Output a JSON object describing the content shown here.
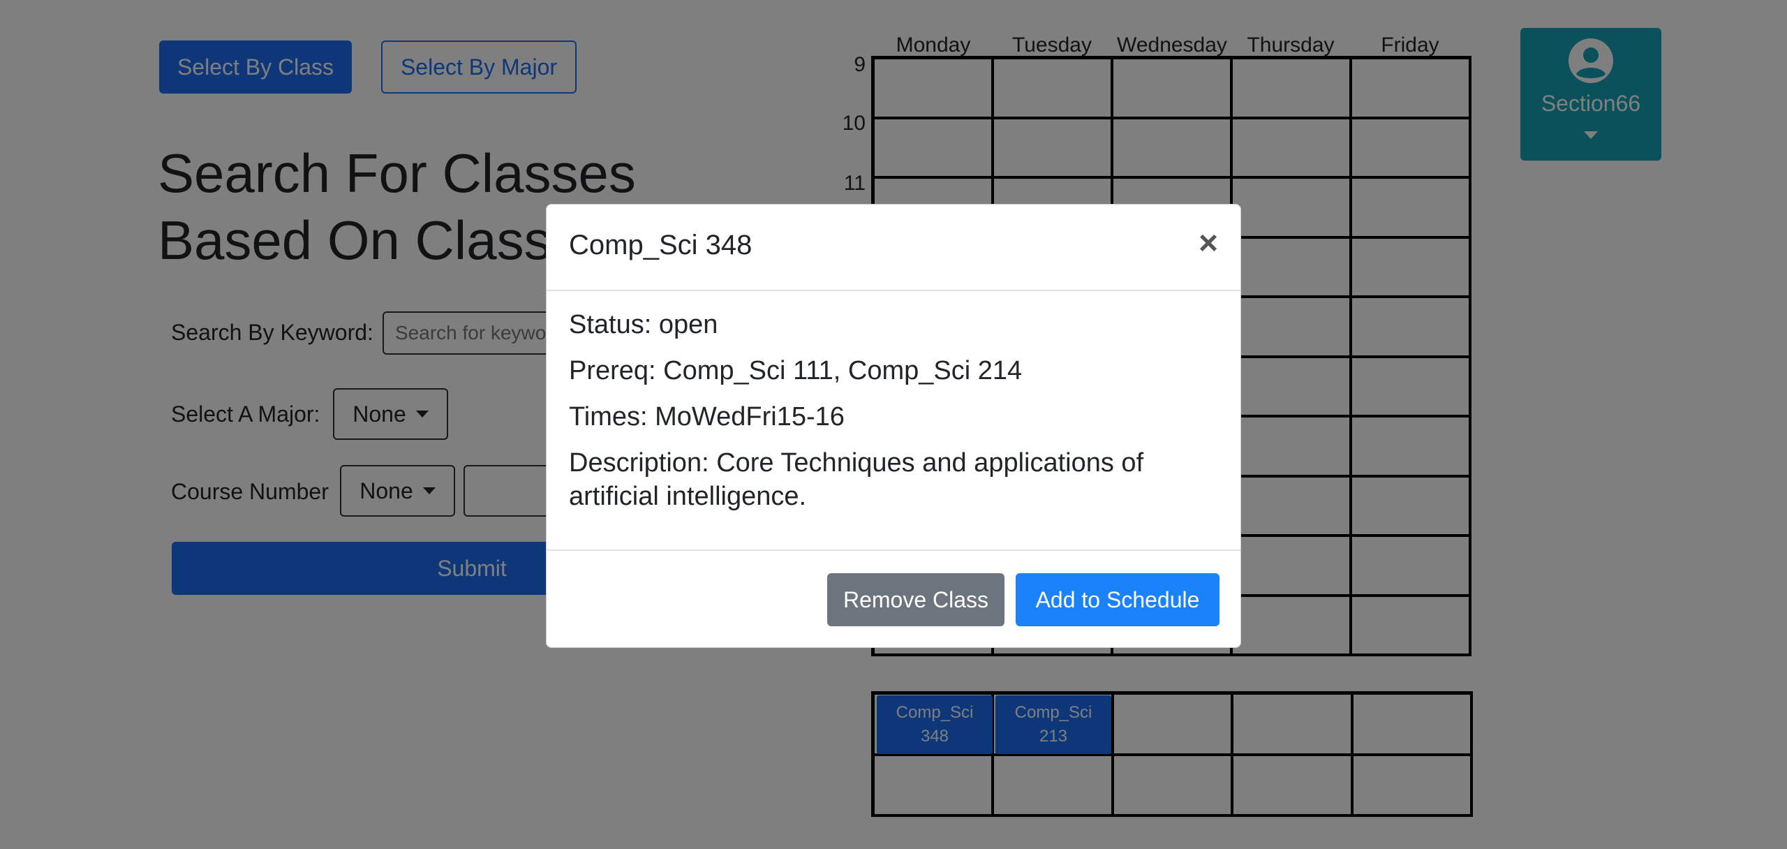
{
  "toolbar": {
    "by_class_label": "Select By Class",
    "by_major_label": "Select By Major"
  },
  "page": {
    "title_line1": "Search For Classes",
    "title_line2": "Based On Class"
  },
  "form": {
    "keyword_label": "Search By Keyword:",
    "keyword_placeholder": "Search for keywords",
    "major_label": "Select A Major:",
    "major_value": "None",
    "course_number_label": "Course Number",
    "course_number_value": "None",
    "course_number_input": "",
    "submit_label": "Submit"
  },
  "schedule": {
    "days": [
      "Monday",
      "Tuesday",
      "Wednesday",
      "Thursday",
      "Friday"
    ],
    "hours": [
      "9",
      "10",
      "11"
    ],
    "selected_classes": [
      {
        "line1": "Comp_Sci",
        "line2": "348"
      },
      {
        "line1": "Comp_Sci",
        "line2": "213"
      }
    ]
  },
  "user": {
    "name": "Section66",
    "avatar_icon": "user-circle-icon",
    "caret_icon": "caret-down-icon"
  },
  "modal": {
    "title": "Comp_Sci 348",
    "close_symbol": "×",
    "status": "Status: open",
    "prereq": "Prereq: Comp_Sci 111, Comp_Sci 214",
    "times": "Times: MoWedFri15-16",
    "description": "Description: Core Techniques and applications of artificial intelligence.",
    "remove_label": "Remove Class",
    "add_label": "Add to Schedule"
  },
  "colors": {
    "primary": "#1c6ef2",
    "secondary": "#6c757d",
    "user_card": "#17a2b8",
    "add_button": "#1a82fb"
  }
}
